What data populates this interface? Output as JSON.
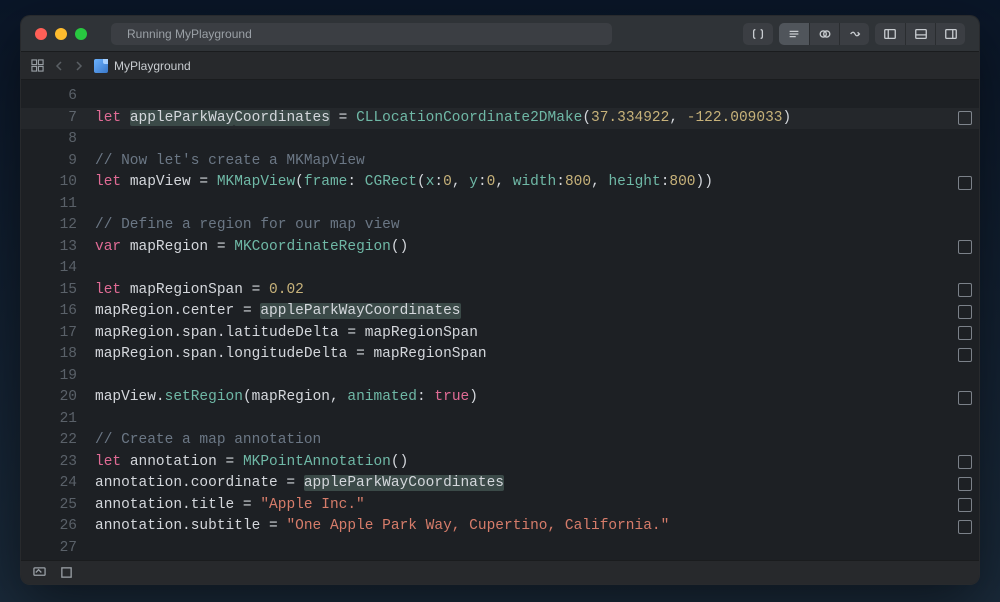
{
  "titlebar": {
    "status_text": "Running MyPlayground"
  },
  "tabbar": {
    "filename": "MyPlayground"
  },
  "gutter_start": 6,
  "gutter_end": 27,
  "code_lines": [
    {
      "n": 6,
      "tokens": [],
      "marker": false
    },
    {
      "n": 7,
      "tokens": [
        {
          "t": "let ",
          "c": "kw"
        },
        {
          "t": "appleParkWay",
          "c": "id hl-token"
        },
        {
          "t": "Coordinates",
          "c": "id hl-token"
        },
        {
          "t": " = ",
          "c": "punc"
        },
        {
          "t": "CLLocationCoordinate2DMake",
          "c": "type"
        },
        {
          "t": "(",
          "c": "punc"
        },
        {
          "t": "37.334922",
          "c": "num"
        },
        {
          "t": ", ",
          "c": "punc"
        },
        {
          "t": "-122.009033",
          "c": "num"
        },
        {
          "t": ")",
          "c": "punc"
        }
      ],
      "marker": true
    },
    {
      "n": 8,
      "tokens": [],
      "marker": false
    },
    {
      "n": 9,
      "tokens": [
        {
          "t": "// Now let's create a MKMapView",
          "c": "cmt"
        }
      ],
      "marker": false
    },
    {
      "n": 10,
      "tokens": [
        {
          "t": "let ",
          "c": "kw"
        },
        {
          "t": "mapView",
          "c": "id"
        },
        {
          "t": " = ",
          "c": "punc"
        },
        {
          "t": "MKMapView",
          "c": "type"
        },
        {
          "t": "(",
          "c": "punc"
        },
        {
          "t": "frame",
          "c": "arg"
        },
        {
          "t": ": ",
          "c": "punc"
        },
        {
          "t": "CGRect",
          "c": "type"
        },
        {
          "t": "(",
          "c": "punc"
        },
        {
          "t": "x",
          "c": "arg"
        },
        {
          "t": ":",
          "c": "punc"
        },
        {
          "t": "0",
          "c": "num"
        },
        {
          "t": ", ",
          "c": "punc"
        },
        {
          "t": "y",
          "c": "arg"
        },
        {
          "t": ":",
          "c": "punc"
        },
        {
          "t": "0",
          "c": "num"
        },
        {
          "t": ", ",
          "c": "punc"
        },
        {
          "t": "width",
          "c": "arg"
        },
        {
          "t": ":",
          "c": "punc"
        },
        {
          "t": "800",
          "c": "num"
        },
        {
          "t": ", ",
          "c": "punc"
        },
        {
          "t": "height",
          "c": "arg"
        },
        {
          "t": ":",
          "c": "punc"
        },
        {
          "t": "800",
          "c": "num"
        },
        {
          "t": "))",
          "c": "punc"
        }
      ],
      "marker": true
    },
    {
      "n": 11,
      "tokens": [],
      "marker": false
    },
    {
      "n": 12,
      "tokens": [
        {
          "t": "// Define a region for our map view",
          "c": "cmt"
        }
      ],
      "marker": false
    },
    {
      "n": 13,
      "tokens": [
        {
          "t": "var ",
          "c": "kw"
        },
        {
          "t": "mapRegion",
          "c": "id"
        },
        {
          "t": " = ",
          "c": "punc"
        },
        {
          "t": "MKCoordinateRegion",
          "c": "type"
        },
        {
          "t": "()",
          "c": "punc"
        }
      ],
      "marker": true
    },
    {
      "n": 14,
      "tokens": [],
      "marker": false
    },
    {
      "n": 15,
      "tokens": [
        {
          "t": "let ",
          "c": "kw"
        },
        {
          "t": "mapRegionSpan",
          "c": "id"
        },
        {
          "t": " = ",
          "c": "punc"
        },
        {
          "t": "0.02",
          "c": "num"
        }
      ],
      "marker": true
    },
    {
      "n": 16,
      "tokens": [
        {
          "t": "mapRegion",
          "c": "id"
        },
        {
          "t": ".",
          "c": "punc"
        },
        {
          "t": "center",
          "c": "prop"
        },
        {
          "t": " = ",
          "c": "punc"
        },
        {
          "t": "appleParkWayCoordinates",
          "c": "id hl-token"
        }
      ],
      "marker": true
    },
    {
      "n": 17,
      "tokens": [
        {
          "t": "mapRegion",
          "c": "id"
        },
        {
          "t": ".",
          "c": "punc"
        },
        {
          "t": "span",
          "c": "prop"
        },
        {
          "t": ".",
          "c": "punc"
        },
        {
          "t": "latitudeDelta",
          "c": "prop"
        },
        {
          "t": " = ",
          "c": "punc"
        },
        {
          "t": "mapRegionSpan",
          "c": "id"
        }
      ],
      "marker": true
    },
    {
      "n": 18,
      "tokens": [
        {
          "t": "mapRegion",
          "c": "id"
        },
        {
          "t": ".",
          "c": "punc"
        },
        {
          "t": "span",
          "c": "prop"
        },
        {
          "t": ".",
          "c": "punc"
        },
        {
          "t": "longitudeDelta",
          "c": "prop"
        },
        {
          "t": " = ",
          "c": "punc"
        },
        {
          "t": "mapRegionSpan",
          "c": "id"
        }
      ],
      "marker": true
    },
    {
      "n": 19,
      "tokens": [],
      "marker": false
    },
    {
      "n": 20,
      "tokens": [
        {
          "t": "mapView",
          "c": "id"
        },
        {
          "t": ".",
          "c": "punc"
        },
        {
          "t": "setRegion",
          "c": "fn"
        },
        {
          "t": "(",
          "c": "punc"
        },
        {
          "t": "mapRegion",
          "c": "id"
        },
        {
          "t": ", ",
          "c": "punc"
        },
        {
          "t": "animated",
          "c": "arg"
        },
        {
          "t": ": ",
          "c": "punc"
        },
        {
          "t": "true",
          "c": "bool"
        },
        {
          "t": ")",
          "c": "punc"
        }
      ],
      "marker": true
    },
    {
      "n": 21,
      "tokens": [],
      "marker": false
    },
    {
      "n": 22,
      "tokens": [
        {
          "t": "// Create a map annotation",
          "c": "cmt"
        }
      ],
      "marker": false
    },
    {
      "n": 23,
      "tokens": [
        {
          "t": "let ",
          "c": "kw"
        },
        {
          "t": "annotation",
          "c": "id"
        },
        {
          "t": " = ",
          "c": "punc"
        },
        {
          "t": "MKPointAnnotation",
          "c": "type"
        },
        {
          "t": "()",
          "c": "punc"
        }
      ],
      "marker": true
    },
    {
      "n": 24,
      "tokens": [
        {
          "t": "annotation",
          "c": "id"
        },
        {
          "t": ".",
          "c": "punc"
        },
        {
          "t": "coordinate",
          "c": "prop"
        },
        {
          "t": " = ",
          "c": "punc"
        },
        {
          "t": "appleParkWayCoordinates",
          "c": "id hl-token"
        }
      ],
      "marker": true
    },
    {
      "n": 25,
      "tokens": [
        {
          "t": "annotation",
          "c": "id"
        },
        {
          "t": ".",
          "c": "punc"
        },
        {
          "t": "title",
          "c": "prop"
        },
        {
          "t": " = ",
          "c": "punc"
        },
        {
          "t": "\"Apple Inc.\"",
          "c": "str"
        }
      ],
      "marker": true
    },
    {
      "n": 26,
      "tokens": [
        {
          "t": "annotation",
          "c": "id"
        },
        {
          "t": ".",
          "c": "punc"
        },
        {
          "t": "subtitle",
          "c": "prop"
        },
        {
          "t": " = ",
          "c": "punc"
        },
        {
          "t": "\"One Apple Park Way, Cupertino, California.\"",
          "c": "str"
        }
      ],
      "marker": true
    },
    {
      "n": 27,
      "tokens": [],
      "marker": false
    }
  ]
}
